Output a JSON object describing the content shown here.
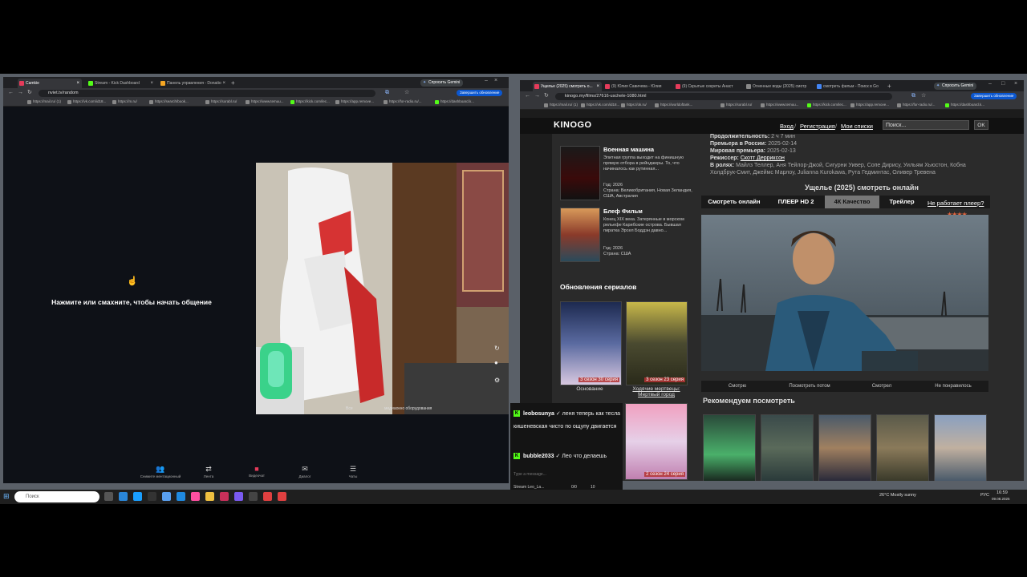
{
  "left_browser": {
    "tabs": [
      {
        "label": "Camkie",
        "color": "#e53b5a"
      },
      {
        "label": "Stream - Kick Dashboard",
        "color": "#53fc18"
      },
      {
        "label": "Панель управления - Donatio",
        "color": "#f5a623"
      }
    ],
    "gemini": "Спросить Gemini",
    "url": "nviet.tv/random",
    "update_btn": "Завершить обновление",
    "bookmarks": [
      "https://mail.ru/ (1)",
      "https://vk.com/id18...",
      "https://m.ru/",
      "https://search/book...",
      "https://sorabl.ru/",
      "https://www.temuu...",
      "https://kick.com/lec...",
      "https://app.remove...",
      "https://for-radio.ru/...",
      "https://dashboard.k..."
    ]
  },
  "chat_app": {
    "prompt": "Нажмите или смахните, чтобы начать общение",
    "cam_labels": [
      "Все",
      "медиаокно оборудования"
    ],
    "nav": [
      {
        "label": "Снимите ментационный",
        "icon": "people-icon"
      },
      {
        "label": "Лента",
        "icon": "shuffle-icon"
      },
      {
        "label": "Видеочат",
        "icon": "video-icon"
      },
      {
        "label": "Диалог",
        "icon": "chat-icon"
      },
      {
        "label": "Чаты",
        "icon": "chats-icon"
      }
    ]
  },
  "right_browser": {
    "tabs": [
      {
        "label": "Ущелье (2025) смотреть о...",
        "color": "#e53b5a"
      },
      {
        "label": "(9) Юлия Савичева - Юлия",
        "color": "#e53b5a"
      },
      {
        "label": "(9) Скрытые секреты Анаст",
        "color": "#e53b5a"
      },
      {
        "label": "Огненные воды (2025) смотр",
        "color": "#888"
      },
      {
        "label": "смотреть фильм - Поиск в Go",
        "color": "#4285f4"
      }
    ],
    "gemini": "Спросить Gemini",
    "url": "kinogo.my/films/27616-uschele-1080.html",
    "update_btn": "Завершить обновление",
    "bookmarks": [
      "https://mail.ru/ (1)",
      "https://vk.com/id18...",
      "https://ok.ru/",
      "https://worldoftank...",
      "https://sorabl.ru/",
      "https://www.temuu...",
      "https://kick.com/lec...",
      "https://app.remove...",
      "https://for-radio.ru/...",
      "https://dashboard.k..."
    ]
  },
  "site": {
    "logo": "KINOGO",
    "links": {
      "login": "Вход",
      "register": "Регистрация",
      "lists": "Мои списки"
    },
    "search_placeholder": "Поиск...",
    "ok": "OK",
    "sidebar_films": [
      {
        "title": "Военная машина",
        "desc": "Элитная группа выходит на финишную прямую отбора в рейнджеры. То, что начиналось как рутинная...",
        "meta": "Год: 2026\nСтрана: Великобритания, Новая Зеландия, США, Австралия"
      },
      {
        "title": "Блеф Фильм",
        "desc": "Конец XIX века. Затерянные в морском рельефе Карибские острова. Бывшая пиратка Эрсел Боддэн давно...",
        "meta": "Год: 2026\nСтрана: США"
      }
    ],
    "series_heading": "Обновления сериалов",
    "series": [
      {
        "name": "Основание",
        "episode": "3 сезон 30 серия"
      },
      {
        "name": "Ходячие мертвецы: Мертвый город",
        "episode": "3 сезон 23 серия"
      }
    ],
    "info": {
      "duration_label": "Продолжительность:",
      "duration": "2 ч 7 мин",
      "premiere_ru_label": "Премьера в России:",
      "premiere_ru": "2025-02-14",
      "premiere_world_label": "Мировая премьера:",
      "premiere_world": "2025-02-13",
      "director_label": "Режиссер:",
      "director": "Скотт Дерриксон",
      "cast_label": "В ролях:",
      "cast": "Майлз Теллер, Аня Тейлор-Джой, Сигурни Уивер, Сопе Дирису, Уильям Хьюстон, Кобна Холдбрук-Смит, Джеймс Марлоу, Julianna Kurokawa, Рута Гедминтас, Оливер Тревена"
    },
    "page_title": "Ущелье (2025) смотреть онлайн",
    "player_tabs": [
      "Смотреть онлайн",
      "ПЛЕЕР HD 2",
      "4К Качество",
      "Трейлер"
    ],
    "not_working": "Не работает плеер?",
    "votes": [
      "Смотрю",
      "Посмотреть потом",
      "Смотрел",
      "Не понравилось"
    ],
    "recommend_heading": "Рекомендуем посмотреть"
  },
  "chat_overlay": {
    "messages": [
      {
        "user": "leobosunya",
        "text": "леня теперь как тесла кишеневская чисто по ощупу двигается"
      },
      {
        "user": "bubble2033",
        "text": "Лео что делаешь"
      }
    ],
    "input_placeholder": "Type a message...",
    "counter": "0/0",
    "viewers": "10",
    "stream_label": "Stream Leo_La...",
    "anime_episode": "2 сезон 24 серия"
  },
  "taskbar": {
    "search": "Поиск",
    "weather": "26°C  Mostly sunny",
    "lang": "РУС",
    "time": "16:59",
    "date": "09.08.2025"
  }
}
